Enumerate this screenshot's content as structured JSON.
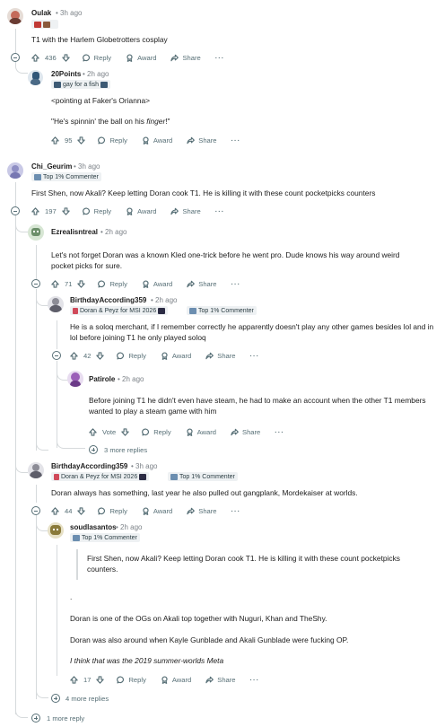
{
  "colors": {
    "text": "#1c1c1c",
    "meta": "#576f76",
    "thread_line": "#d6dadc",
    "flair_bg": "#eef1f3"
  },
  "icons": {
    "upvote": "arrow-up-icon",
    "downvote": "arrow-down-icon",
    "reply": "speech-bubble-icon",
    "award": "award-ribbon-icon",
    "share": "share-arrow-icon",
    "more": "ellipsis-icon",
    "collapse": "minus-circle-icon",
    "expand": "plus-circle-icon",
    "flair_emoji": "flair-emoji-icon"
  },
  "actions": {
    "reply": "Reply",
    "award": "Award",
    "share": "Share",
    "more": "···",
    "vote": "Vote"
  },
  "comments": {
    "c1": {
      "user": "Oulak",
      "time": "• 3h ago",
      "text": "T1 with the Harlem Globetrotters cosplay",
      "score": "436"
    },
    "c2": {
      "user": "20Points",
      "time": "• 2h ago",
      "flair": "gay for a fish",
      "text1": "<pointing at Faker's Orianna>",
      "text2_pre": "\"He's spinnin' the ball on his ",
      "text2_em": "finger",
      "text2_post": "!\"",
      "score": "95"
    },
    "c3": {
      "user": "Chi_Geurim",
      "time": "• 3h ago",
      "flair": "Top 1% Commenter",
      "text": "First Shen, now Akali? Keep letting Doran cook T1. He is killing it with these count pocketpicks counters",
      "score": "197"
    },
    "c4": {
      "user": "Ezrealisntreal",
      "time": "• 2h ago",
      "text": "Let's not forget Doran was a known Kled one-trick before he went pro. Dude knows his way around weird pocket picks for sure.",
      "score": "71"
    },
    "c5": {
      "user": "BirthdayAccording359",
      "time": "• 2h ago",
      "flair1": "Doran & Peyz for MSI 2026",
      "flair2": "Top 1% Commenter",
      "text": "He is a soloq merchant, if I remember correctly he apparently doesn't play any other games besides lol and in lol before joining T1 he only played soloq",
      "score": "42"
    },
    "c6": {
      "user": "Patirole",
      "time": "• 2h ago",
      "text": "Before joining T1 he didn't even have steam, he had to make an account when the other T1 members wanted to play a steam game with him"
    },
    "more1": "3 more replies",
    "c7": {
      "user": "BirthdayAccording359",
      "time": "• 3h ago",
      "flair1": "Doran & Peyz for MSI 2026",
      "flair2": "Top 1% Commenter",
      "text": "Doran always has something, last year he also pulled out gangplank, Mordekaiser at worlds.",
      "score": "44"
    },
    "c8": {
      "user": "soudlasantos",
      "time": "• 2h ago",
      "flair": "Top 1% Commenter",
      "quote": "First Shen, now Akali? Keep letting Doran cook T1. He is killing it with these count pocketpicks counters.",
      "dot": ".",
      "p1": "Doran is one of the OGs on Akali top together with Nuguri, Khan and TheShy.",
      "p2": "Doran was also around when Kayle Gunblade and Akali Gunblade were fucking OP.",
      "p3": "I think that was the 2019 summer-worlds Meta",
      "score": "17"
    },
    "more2": "4 more replies",
    "more3": "1 more reply"
  }
}
